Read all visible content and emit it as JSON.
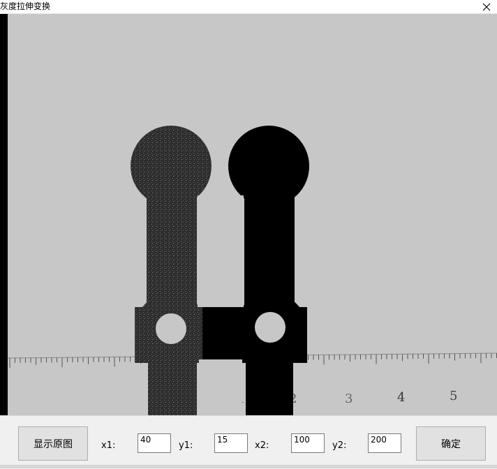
{
  "window": {
    "title": "灰度拉伸变换",
    "close_glyph": "✕"
  },
  "image": {
    "ruler_numbers": [
      "1",
      "2",
      "3",
      "4",
      "5"
    ]
  },
  "controls": {
    "show_original_label": "显示原图",
    "confirm_label": "确定",
    "x1_label": "x1:",
    "y1_label": "y1:",
    "x2_label": "x2:",
    "y2_label": "y2:",
    "x1_value": "40",
    "y1_value": "15",
    "x2_value": "100",
    "y2_value": "200"
  }
}
